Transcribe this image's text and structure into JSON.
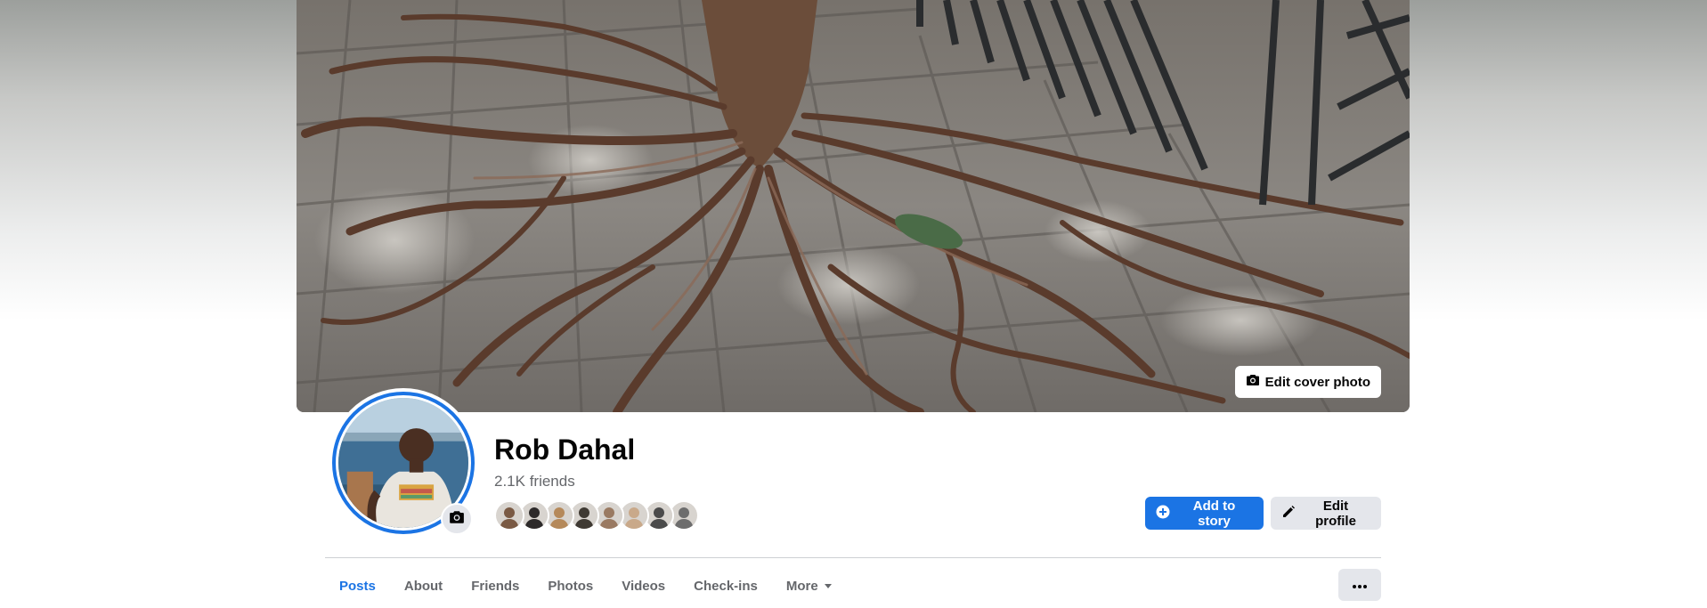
{
  "profile": {
    "name": "Rob Dahal",
    "friends_count": "2.1K friends",
    "friend_avatar_colors": [
      "#7a5a44",
      "#2d2a2a",
      "#b5895a",
      "#3f3a33",
      "#9a7a62",
      "#c9a98a",
      "#4b4b4b",
      "#6d6d6d"
    ]
  },
  "cover": {
    "edit_label": "Edit cover photo"
  },
  "actions": {
    "add_story_label": "Add to story",
    "edit_profile_label": "Edit profile"
  },
  "tabs": [
    {
      "label": "Posts",
      "active": true
    },
    {
      "label": "About"
    },
    {
      "label": "Friends"
    },
    {
      "label": "Photos"
    },
    {
      "label": "Videos"
    },
    {
      "label": "Check-ins"
    },
    {
      "label": "More"
    }
  ],
  "colors": {
    "accent": "#1b74e4",
    "secondary_button": "#e4e6eb",
    "muted_text": "#65676b"
  },
  "icons": {
    "camera": "camera-icon",
    "plus_circle": "plus-circle-icon",
    "pencil": "pencil-icon",
    "caret": "caret-down-icon",
    "dots": "more-dots-icon"
  }
}
